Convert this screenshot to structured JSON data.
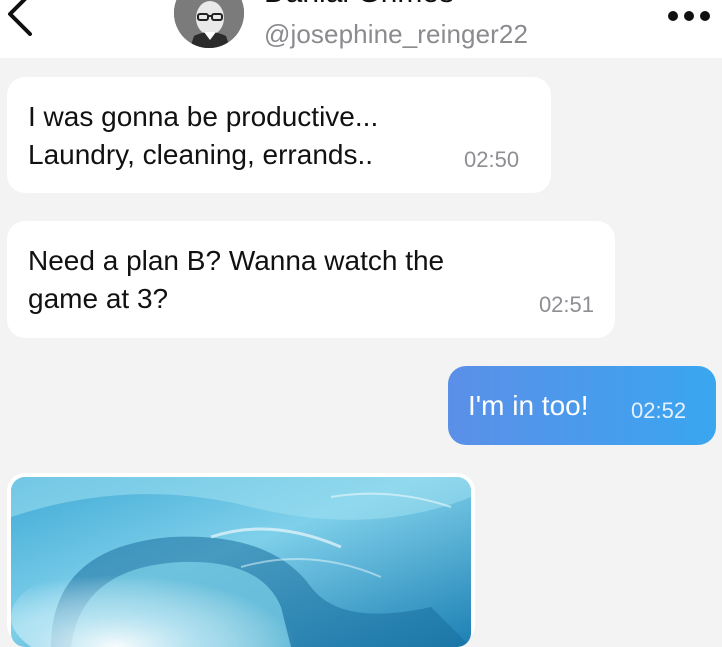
{
  "header": {
    "contact_name": "Danial Grimes",
    "contact_handle": "@josephine_reinger22",
    "back_icon": "chevron-left-icon",
    "more_icon": "more-dots-icon"
  },
  "messages": [
    {
      "direction": "incoming",
      "lines": [
        "I was gonna be productive...",
        "Laundry, cleaning, errands.."
      ],
      "time": "02:50"
    },
    {
      "direction": "incoming",
      "lines": [
        "Need a plan B? Wanna watch the",
        "game at 3?"
      ],
      "time": "02:51"
    },
    {
      "direction": "outgoing",
      "lines": [
        "I'm in too!"
      ],
      "time": "02:52"
    },
    {
      "direction": "incoming",
      "type": "image",
      "image_subject": "ocean-wave"
    }
  ],
  "colors": {
    "outgoing_bubble_start": "#5b8fe8",
    "outgoing_bubble_end": "#3aa6f0",
    "background": "#f3f3f4",
    "timestamp": "#8e8e93"
  }
}
